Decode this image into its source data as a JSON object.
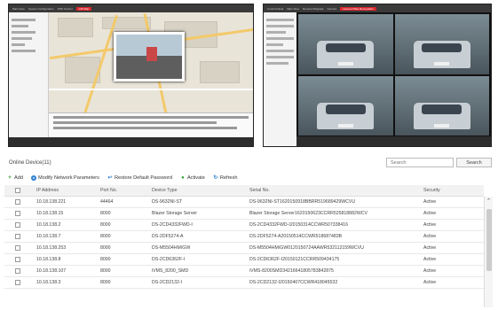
{
  "left_screen": {
    "tabs": [
      "Main View",
      "System Configuration",
      "VMS Control",
      "GIS Map"
    ],
    "active_tab": "GIS Map"
  },
  "right_screen": {
    "tabs": [
      "Control Panel",
      "Main View",
      "Remote Playback",
      "Camera",
      "License Plate Recognition"
    ],
    "active_tab": "License Plate Recognition"
  },
  "online_device": {
    "title": "Online Device(11)",
    "search_placeholder": "Search",
    "search_button": "Search"
  },
  "toolbar": {
    "add": "Add",
    "modify": "Modify Network Parameters",
    "restore": "Restore Default Password",
    "activate": "Activate",
    "refresh": "Refresh"
  },
  "table": {
    "columns": [
      "IP Address",
      "Port No.",
      "Device Type",
      "Serial No.",
      "Security"
    ],
    "rows": [
      [
        "10.18.138.221",
        "44464",
        "DS-9632NI-ST",
        "DS-9632NI-ST1620150918BBRR519689429WCVU",
        "Active"
      ],
      [
        "10.18.138.15",
        "8000",
        "Blazer Storage Server",
        "Blazer Storage Server1620150623CCRR525818882WCV",
        "Active"
      ],
      [
        "10.18.138.2",
        "8000",
        "DS-2CD4332FWD-I",
        "DS-2CD4332FWD-I20150314CCWR507338416",
        "Active"
      ],
      [
        "10.18.138.7",
        "8000",
        "DS-2DF5274-A",
        "DS-2DF5274-A20150514CCWR518687483B",
        "Active"
      ],
      [
        "10.18.138.253",
        "8000",
        "DS-M5504HM/GW",
        "DS-M5504HM/GW0120150724AAWR532112159WCVU",
        "Active"
      ],
      [
        "10.18.138.8",
        "8000",
        "DS-2CD6362F-I",
        "DS-2CD6362F-I20150121CCRR509434175",
        "Active"
      ],
      [
        "10.18.138.107",
        "8000",
        "iVMS_8200_SMD",
        "iVMS-8200SMD34216641805783842875",
        "Active"
      ],
      [
        "10.18.138.3",
        "8000",
        "DS-2CD2132-I",
        "DS-2CD2132-I20150407CCWR418045532",
        "Active"
      ]
    ]
  },
  "colors": {
    "accent_red": "#d7262b",
    "add_green": "#2aa12a",
    "link_blue": "#2d80d2"
  }
}
